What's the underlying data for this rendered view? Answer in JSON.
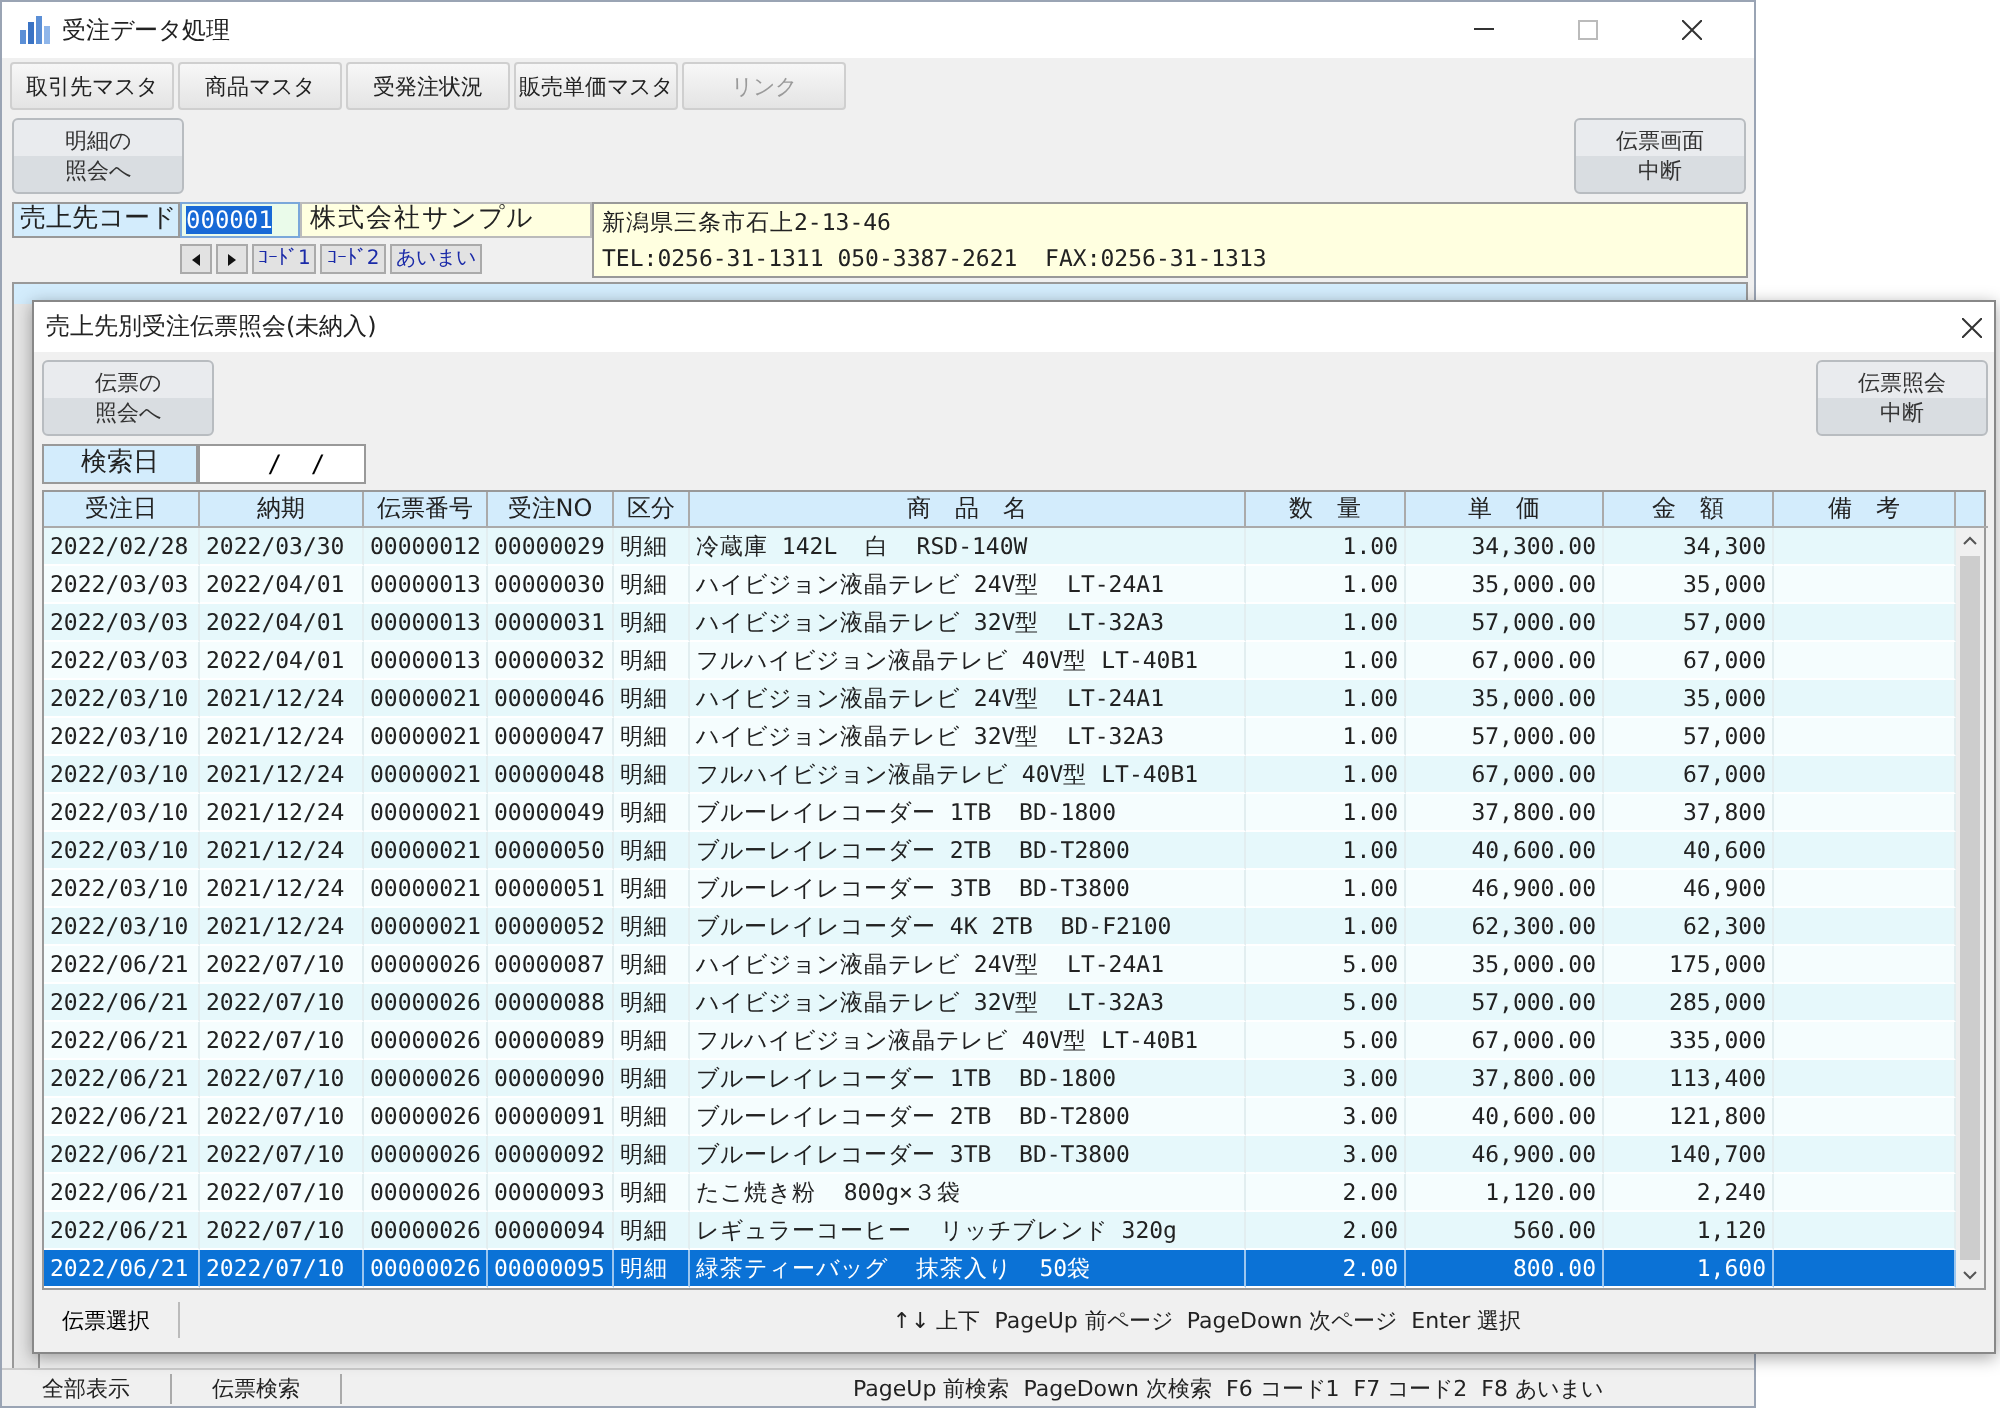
{
  "window": {
    "title": "受注データ処理"
  },
  "toolbar": [
    {
      "label": "取引先マスタ",
      "disabled": false
    },
    {
      "label": "商品マスタ",
      "disabled": false
    },
    {
      "label": "受発注状況",
      "disabled": false
    },
    {
      "label": "販売単価マスタ",
      "disabled": false
    },
    {
      "label": "リンク",
      "disabled": true
    }
  ],
  "detail_button": [
    "明細の",
    "照会へ"
  ],
  "abort_button": [
    "伝票画面",
    "中断"
  ],
  "customer": {
    "label": "売上先コード",
    "code": "000001",
    "name": "株式会社サンプル",
    "address": "新潟県三条市石上2-13-46",
    "phone": "TEL:0256-31-1311 050-3387-2621  FAX:0256-31-1313"
  },
  "nav_buttons": [
    {
      "kind": "prev"
    },
    {
      "kind": "next"
    },
    {
      "kind": "text",
      "label": "ｺｰﾄﾞ1"
    },
    {
      "kind": "text",
      "label": "ｺｰﾄﾞ2"
    },
    {
      "kind": "text",
      "label": "あいまい"
    }
  ],
  "status_bar": {
    "buttons": [
      "全部表示",
      "伝票検索"
    ],
    "help": "PageUp 前検索  PageDown 次検索  F6 コード1  F7 コード2  F8 あいまい"
  },
  "dialog": {
    "title": "売上先別受注伝票照会(未納入)",
    "open_button": [
      "伝票の",
      "照会へ"
    ],
    "abort_button": [
      "伝票照会",
      "中断"
    ],
    "search": {
      "label": "検索日",
      "value": "  /  /"
    },
    "columns": [
      "受注日",
      "納期",
      "伝票番号",
      "受注NO",
      "区分",
      "商　品　名",
      "数　量",
      "単　価",
      "金　額",
      "備　考"
    ],
    "rows": [
      {
        "cells": [
          "2022/02/28",
          "2022/03/30",
          "00000012",
          "00000029",
          "明細",
          "冷蔵庫 142L  白  RSD-140W",
          "1.00",
          "34,300.00",
          "34,300"
        ],
        "selected": false
      },
      {
        "cells": [
          "2022/03/03",
          "2022/04/01",
          "00000013",
          "00000030",
          "明細",
          "ハイビジョン液晶テレビ 24V型  LT-24A1",
          "1.00",
          "35,000.00",
          "35,000"
        ],
        "selected": false
      },
      {
        "cells": [
          "2022/03/03",
          "2022/04/01",
          "00000013",
          "00000031",
          "明細",
          "ハイビジョン液晶テレビ 32V型  LT-32A3",
          "1.00",
          "57,000.00",
          "57,000"
        ],
        "selected": false
      },
      {
        "cells": [
          "2022/03/03",
          "2022/04/01",
          "00000013",
          "00000032",
          "明細",
          "フルハイビジョン液晶テレビ 40V型 LT-40B1",
          "1.00",
          "67,000.00",
          "67,000"
        ],
        "selected": false
      },
      {
        "cells": [
          "2022/03/10",
          "2021/12/24",
          "00000021",
          "00000046",
          "明細",
          "ハイビジョン液晶テレビ 24V型  LT-24A1",
          "1.00",
          "35,000.00",
          "35,000"
        ],
        "selected": false
      },
      {
        "cells": [
          "2022/03/10",
          "2021/12/24",
          "00000021",
          "00000047",
          "明細",
          "ハイビジョン液晶テレビ 32V型  LT-32A3",
          "1.00",
          "57,000.00",
          "57,000"
        ],
        "selected": false
      },
      {
        "cells": [
          "2022/03/10",
          "2021/12/24",
          "00000021",
          "00000048",
          "明細",
          "フルハイビジョン液晶テレビ 40V型 LT-40B1",
          "1.00",
          "67,000.00",
          "67,000"
        ],
        "selected": false
      },
      {
        "cells": [
          "2022/03/10",
          "2021/12/24",
          "00000021",
          "00000049",
          "明細",
          "ブルーレイレコーダー 1TB  BD-1800",
          "1.00",
          "37,800.00",
          "37,800"
        ],
        "selected": false
      },
      {
        "cells": [
          "2022/03/10",
          "2021/12/24",
          "00000021",
          "00000050",
          "明細",
          "ブルーレイレコーダー 2TB  BD-T2800",
          "1.00",
          "40,600.00",
          "40,600"
        ],
        "selected": false
      },
      {
        "cells": [
          "2022/03/10",
          "2021/12/24",
          "00000021",
          "00000051",
          "明細",
          "ブルーレイレコーダー 3TB  BD-T3800",
          "1.00",
          "46,900.00",
          "46,900"
        ],
        "selected": false
      },
      {
        "cells": [
          "2022/03/10",
          "2021/12/24",
          "00000021",
          "00000052",
          "明細",
          "ブルーレイレコーダー 4K 2TB  BD-F2100",
          "1.00",
          "62,300.00",
          "62,300"
        ],
        "selected": false
      },
      {
        "cells": [
          "2022/06/21",
          "2022/07/10",
          "00000026",
          "00000087",
          "明細",
          "ハイビジョン液晶テレビ 24V型  LT-24A1",
          "5.00",
          "35,000.00",
          "175,000"
        ],
        "selected": false
      },
      {
        "cells": [
          "2022/06/21",
          "2022/07/10",
          "00000026",
          "00000088",
          "明細",
          "ハイビジョン液晶テレビ 32V型  LT-32A3",
          "5.00",
          "57,000.00",
          "285,000"
        ],
        "selected": false
      },
      {
        "cells": [
          "2022/06/21",
          "2022/07/10",
          "00000026",
          "00000089",
          "明細",
          "フルハイビジョン液晶テレビ 40V型 LT-40B1",
          "5.00",
          "67,000.00",
          "335,000"
        ],
        "selected": false
      },
      {
        "cells": [
          "2022/06/21",
          "2022/07/10",
          "00000026",
          "00000090",
          "明細",
          "ブルーレイレコーダー 1TB  BD-1800",
          "3.00",
          "37,800.00",
          "113,400"
        ],
        "selected": false
      },
      {
        "cells": [
          "2022/06/21",
          "2022/07/10",
          "00000026",
          "00000091",
          "明細",
          "ブルーレイレコーダー 2TB  BD-T2800",
          "3.00",
          "40,600.00",
          "121,800"
        ],
        "selected": false
      },
      {
        "cells": [
          "2022/06/21",
          "2022/07/10",
          "00000026",
          "00000092",
          "明細",
          "ブルーレイレコーダー 3TB  BD-T3800",
          "3.00",
          "46,900.00",
          "140,700"
        ],
        "selected": false
      },
      {
        "cells": [
          "2022/06/21",
          "2022/07/10",
          "00000026",
          "00000093",
          "明細",
          "たこ焼き粉  800g×３袋",
          "2.00",
          "1,120.00",
          "2,240"
        ],
        "selected": false
      },
      {
        "cells": [
          "2022/06/21",
          "2022/07/10",
          "00000026",
          "00000094",
          "明細",
          "レギュラーコーヒー  リッチブレンド 320g",
          "2.00",
          "560.00",
          "1,120"
        ],
        "selected": false
      },
      {
        "cells": [
          "2022/06/21",
          "2022/07/10",
          "00000026",
          "00000095",
          "明細",
          "緑茶ティーバッグ  抹茶入り  50袋",
          "2.00",
          "800.00",
          "1,600"
        ],
        "selected": true
      }
    ],
    "footer": {
      "button": "伝票選択",
      "help": "↑↓ 上下  PageUp 前ページ  PageDown 次ページ  Enter 選択"
    }
  }
}
